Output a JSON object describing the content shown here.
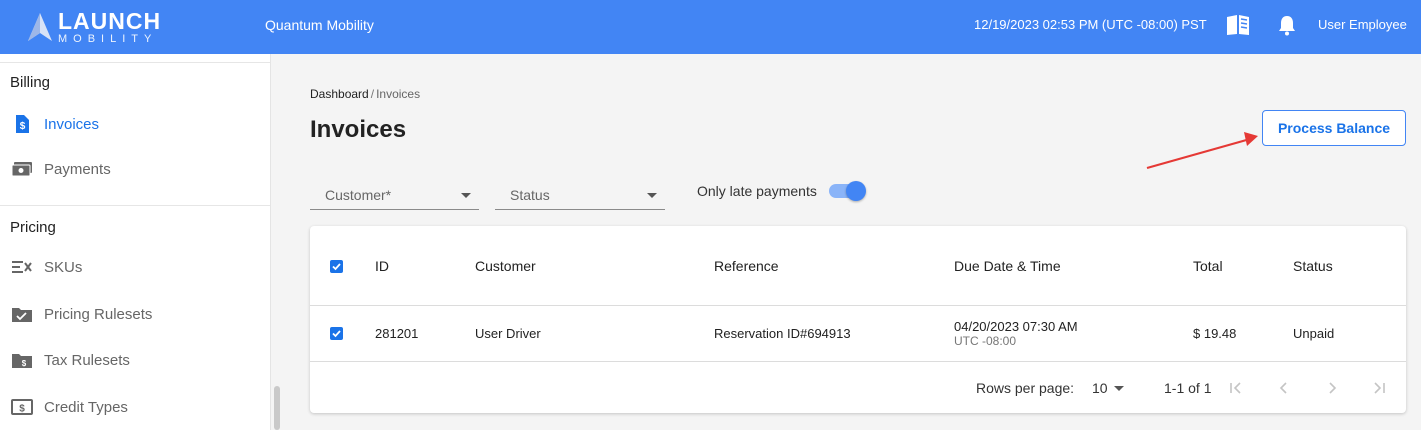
{
  "topbar": {
    "logo_main": "LAUNCH",
    "logo_sub": "MOBILITY",
    "org_name": "Quantum Mobility",
    "datetime": "12/19/2023 02:53 PM (UTC -08:00) PST",
    "user_name": "User Employee",
    "color": "#4285f4"
  },
  "sidebar": {
    "billing_heading": "Billing",
    "billing_items": [
      {
        "label": "Invoices",
        "icon": "invoice-icon",
        "active": true
      },
      {
        "label": "Payments",
        "icon": "payments-icon",
        "active": false
      }
    ],
    "pricing_heading": "Pricing",
    "pricing_items": [
      {
        "label": "SKUs",
        "icon": "skus-icon"
      },
      {
        "label": "Pricing Rulesets",
        "icon": "pricing-rulesets-icon"
      },
      {
        "label": "Tax Rulesets",
        "icon": "tax-rulesets-icon"
      },
      {
        "label": "Credit Types",
        "icon": "credit-types-icon"
      }
    ]
  },
  "breadcrumb": {
    "root": "Dashboard",
    "separator": "/",
    "current": "Invoices"
  },
  "page_title": "Invoices",
  "process_button": "Process Balance",
  "filters": {
    "customer_placeholder": "Customer*",
    "status_placeholder": "Status",
    "late_toggle_label": "Only late payments",
    "late_toggle_on": true
  },
  "table": {
    "headers": [
      "ID",
      "Customer",
      "Reference",
      "Due Date & Time",
      "Total",
      "Status"
    ],
    "select_all_checked": true,
    "rows": [
      {
        "checked": true,
        "id": "281201",
        "customer": "User Driver",
        "reference": "Reservation ID#694913",
        "due_date": "04/20/2023 07:30 AM",
        "due_tz": "UTC -08:00",
        "total": "$ 19.48",
        "status": "Unpaid"
      }
    ],
    "footer": {
      "rows_per_page_label": "Rows per page:",
      "rows_per_page": "10",
      "range": "1-1 of 1"
    }
  },
  "colors": {
    "accent": "#1a73e8",
    "annotation_arrow": "#e53935"
  }
}
